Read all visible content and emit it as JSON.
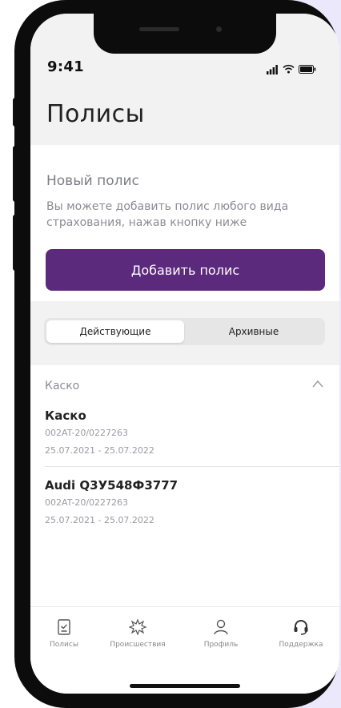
{
  "status_bar": {
    "time": "9:41"
  },
  "page": {
    "title": "Полисы"
  },
  "new_policy": {
    "title": "Новый полис",
    "description": "Вы можете добавить полис любого вида страхования, нажав кнопку ниже",
    "button_label": "Добавить полис"
  },
  "tabs": [
    {
      "label": "Действующие",
      "selected": true
    },
    {
      "label": "Архивные",
      "selected": false
    }
  ],
  "section": {
    "title": "Каско",
    "expanded": true
  },
  "policies": [
    {
      "title": "Каско",
      "number": "002AT-20/0227263",
      "dates": "25.07.2021 - 25.07.2022"
    },
    {
      "title": "Audi Q3У548Ф3777",
      "number": "002AT-20/0227263",
      "dates": "25.07.2021 - 25.07.2022"
    }
  ],
  "tabbar": {
    "items": [
      {
        "label": "Полисы",
        "icon": "policy-icon",
        "active": true
      },
      {
        "label": "Происшествия",
        "icon": "incident-icon",
        "active": false
      },
      {
        "label": "Профиль",
        "icon": "profile-icon",
        "active": false
      },
      {
        "label": "Поддержка",
        "icon": "support-icon",
        "active": false
      }
    ]
  },
  "colors": {
    "accent": "#5c2a7d",
    "background_panel": "#ebe8fb",
    "header_bg": "#f2f2f2"
  }
}
